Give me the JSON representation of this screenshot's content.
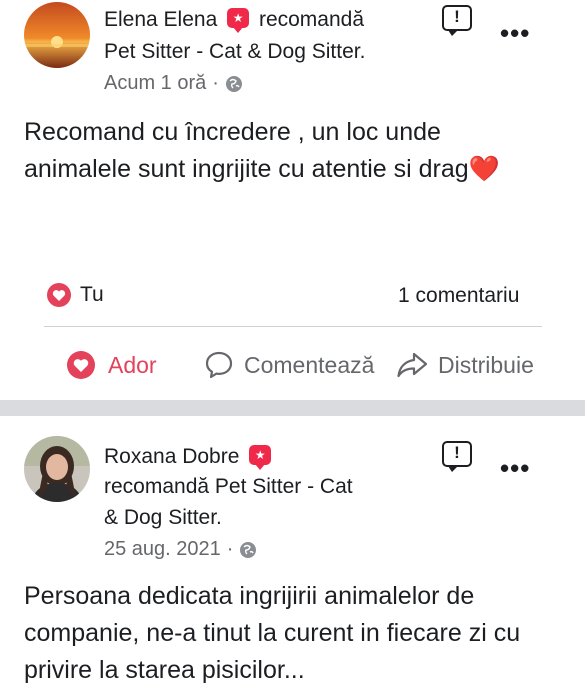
{
  "post1": {
    "author": "Elena Elena",
    "verb": "recomandă",
    "page": "Pet Sitter - Cat & Dog Sitter.",
    "time": "Acum 1 oră",
    "dot": "·",
    "text": "Recomand cu încredere , un loc unde animalele sunt ingrijite cu atentie si drag❤️",
    "reactions_label": "Tu",
    "comments_label": "1 comentariu",
    "actions": {
      "react": "Ador",
      "comment": "Comentează",
      "share": "Distribuie"
    }
  },
  "post2": {
    "author": "Roxana Dobre",
    "verb_line1": "recomandă Pet Sitter - Cat",
    "verb_line2": "& Dog Sitter.",
    "time": "25 aug. 2021",
    "dot": "·",
    "text": "Persoana dedicata ingrijirii animalelor de companie, ne-a tinut la curent in fiecare zi cu privire la starea pisicilor..."
  },
  "icons": {
    "report": "report-flag-icon",
    "more": "more-options-icon",
    "globe": "globe-icon",
    "heart": "heart-reaction-icon",
    "comment": "comment-icon",
    "share": "share-icon",
    "recommend": "recommend-badge-icon"
  },
  "colors": {
    "accent_red": "#f02849",
    "heart_red": "#e4415a",
    "text": "#1c1e21",
    "muted": "#65676b"
  }
}
